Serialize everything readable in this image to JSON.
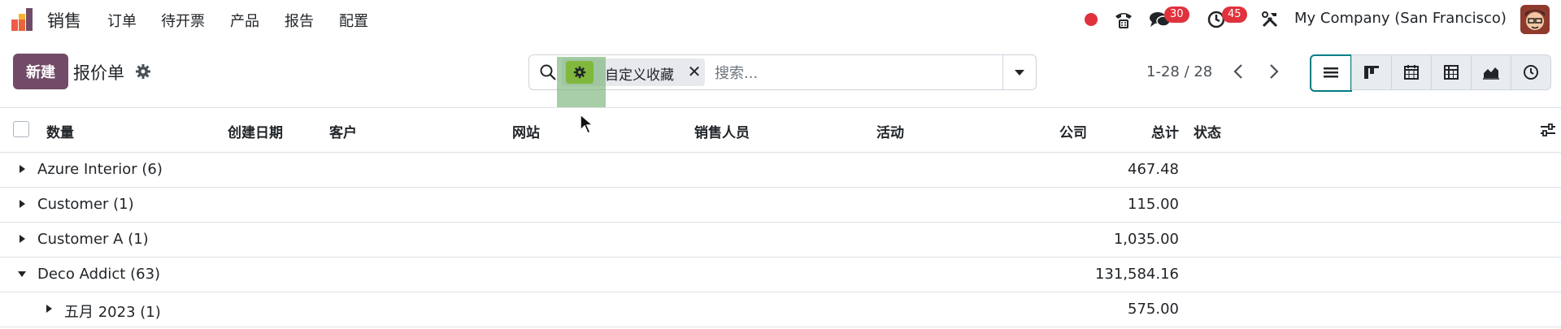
{
  "app": {
    "name": "销售",
    "menu": [
      "订单",
      "待开票",
      "产品",
      "报告",
      "配置"
    ]
  },
  "systray": {
    "messages_count": "30",
    "activities_count": "45",
    "company": "My Company (San Francisco)"
  },
  "control": {
    "new_label": "新建",
    "breadcrumb": "报价单",
    "search": {
      "facet_label": "自定义收藏",
      "placeholder": "搜索..."
    },
    "pager": "1-28 / 28"
  },
  "table": {
    "headers": [
      "数量",
      "创建日期",
      "客户",
      "网站",
      "销售人员",
      "活动",
      "公司",
      "总计",
      "状态"
    ],
    "rows": [
      {
        "label": "Azure Interior (6)",
        "total": "467.48",
        "expanded": false,
        "level": 0
      },
      {
        "label": "Customer (1)",
        "total": "115.00",
        "expanded": false,
        "level": 0
      },
      {
        "label": "Customer A (1)",
        "total": "1,035.00",
        "expanded": false,
        "level": 0
      },
      {
        "label": "Deco Addict (63)",
        "total": "131,584.16",
        "expanded": true,
        "level": 0
      },
      {
        "label": "五月 2023 (1)",
        "total": "575.00",
        "expanded": false,
        "level": 1
      }
    ]
  },
  "colors": {
    "brand": "#714b67",
    "accent": "#017e84",
    "badge": "#e0323c",
    "facet_highlight": "#7fb83c"
  }
}
